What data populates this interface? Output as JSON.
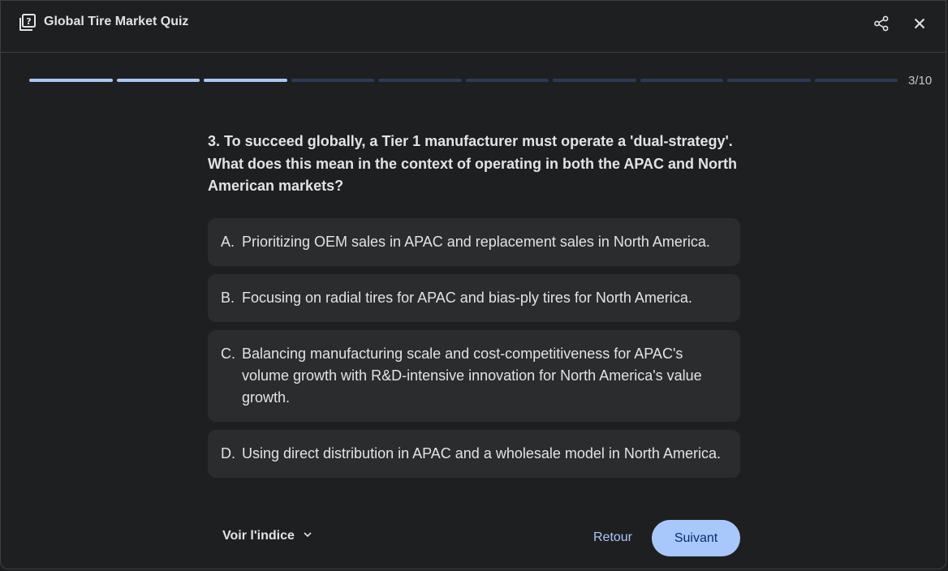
{
  "header": {
    "icon": "quiz-icon",
    "title": "Global Tire Market Quiz",
    "share_icon": "share-icon",
    "close_icon": "close-icon"
  },
  "progress": {
    "current": 3,
    "total": 10,
    "label": "3/10"
  },
  "question": {
    "text": "3. To succeed globally, a Tier 1 manufacturer must operate a 'dual-strategy'. What does this mean in the context of operating in both the APAC and North American markets?"
  },
  "options": [
    {
      "letter": "A.",
      "text": "Prioritizing OEM sales in APAC and replacement sales in North America."
    },
    {
      "letter": "B.",
      "text": "Focusing on radial tires for APAC and bias-ply tires for North America."
    },
    {
      "letter": "C.",
      "text": "Balancing manufacturing scale and cost-competitiveness for APAC's volume growth with R&D-intensive innovation for North America's value growth."
    },
    {
      "letter": "D.",
      "text": "Using direct distribution in APAC and a wholesale model in North America."
    }
  ],
  "footer": {
    "hint_label": "Voir l'indice",
    "hint_icon": "chevron-down-icon",
    "back_label": "Retour",
    "next_label": "Suivant"
  },
  "colors": {
    "background": "#1e1f20",
    "option_bg": "#2b2c2e",
    "accent": "#a8c7fa",
    "progress_inactive": "#2d3a55"
  }
}
